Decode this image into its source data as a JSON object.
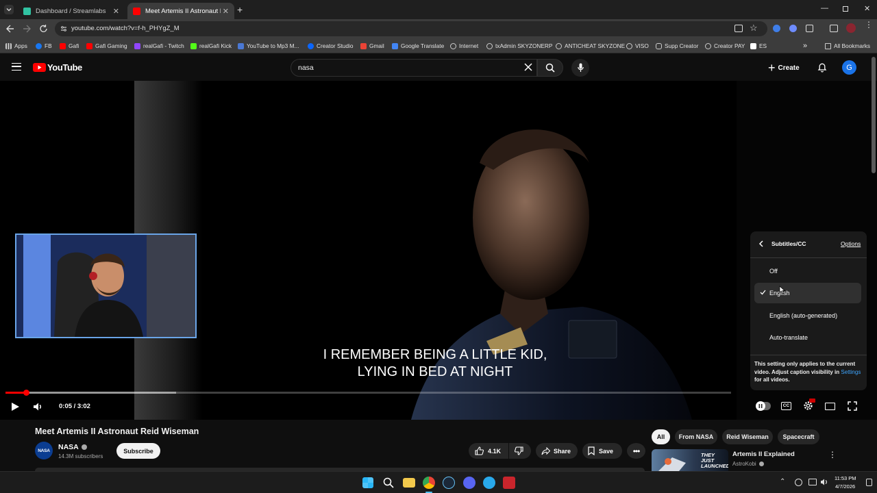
{
  "browser": {
    "tabs": [
      {
        "title": "Dashboard / Streamlabs",
        "active": false
      },
      {
        "title": "Meet Artemis II Astronaut Reid",
        "active": true
      }
    ],
    "url": "youtube.com/watch?v=f-h_PHYgZ_M",
    "bookmarks": [
      "Apps",
      "FB",
      "Gafi",
      "Gafi Gaming",
      "realGafi - Twitch",
      "realGafi Kick",
      "YouTube to Mp3 M...",
      "Creator Studio",
      "Gmail",
      "Google Translate",
      "Internet",
      "txAdmin SKYZONERP",
      "ANTICHEAT SKYZONE",
      "VISO",
      "Supp Creator",
      "Creator PAY",
      "ES"
    ],
    "all_bookmarks": "All Bookmarks"
  },
  "youtube": {
    "logo_text": "YouTube",
    "search_value": "nasa",
    "create_label": "Create",
    "avatar_letter": "G"
  },
  "player": {
    "subtitle_line1": "I REMEMBER BEING A LITTLE KID,",
    "subtitle_line2": "LYING IN BED AT NIGHT",
    "time": "0:05 / 3:02",
    "progress": 0.028,
    "buffered": 0.235
  },
  "cc_menu": {
    "title": "Subtitles/CC",
    "options_label": "Options",
    "items": [
      "Off",
      "English",
      "English (auto-generated)",
      "Auto-translate"
    ],
    "selected": "English",
    "note_text": "This setting only applies to the current video. Adjust caption visibility in",
    "note_link": "Settings",
    "note_suffix": "for all videos."
  },
  "video_info": {
    "title": "Meet Artemis II Astronaut Reid Wiseman",
    "channel": "NASA",
    "subscribers": "14.3M subscribers",
    "subscribe_label": "Subscribe",
    "likes": "4.1K",
    "share_label": "Share",
    "save_label": "Save"
  },
  "chips": [
    "All",
    "From NASA",
    "Reid Wiseman",
    "Spacecraft"
  ],
  "recommendation": {
    "title": "Artemis II Explained",
    "channel": "AstroKobi",
    "thumb_text": "THEY JUST LAUNCHED"
  },
  "taskbar": {
    "time": "11:53 PM",
    "date": "4/7/2026"
  },
  "colors": {
    "youtube_red": "#ff0000",
    "link_blue": "#3ea6ff",
    "avatar_blue": "#1a73e8"
  }
}
